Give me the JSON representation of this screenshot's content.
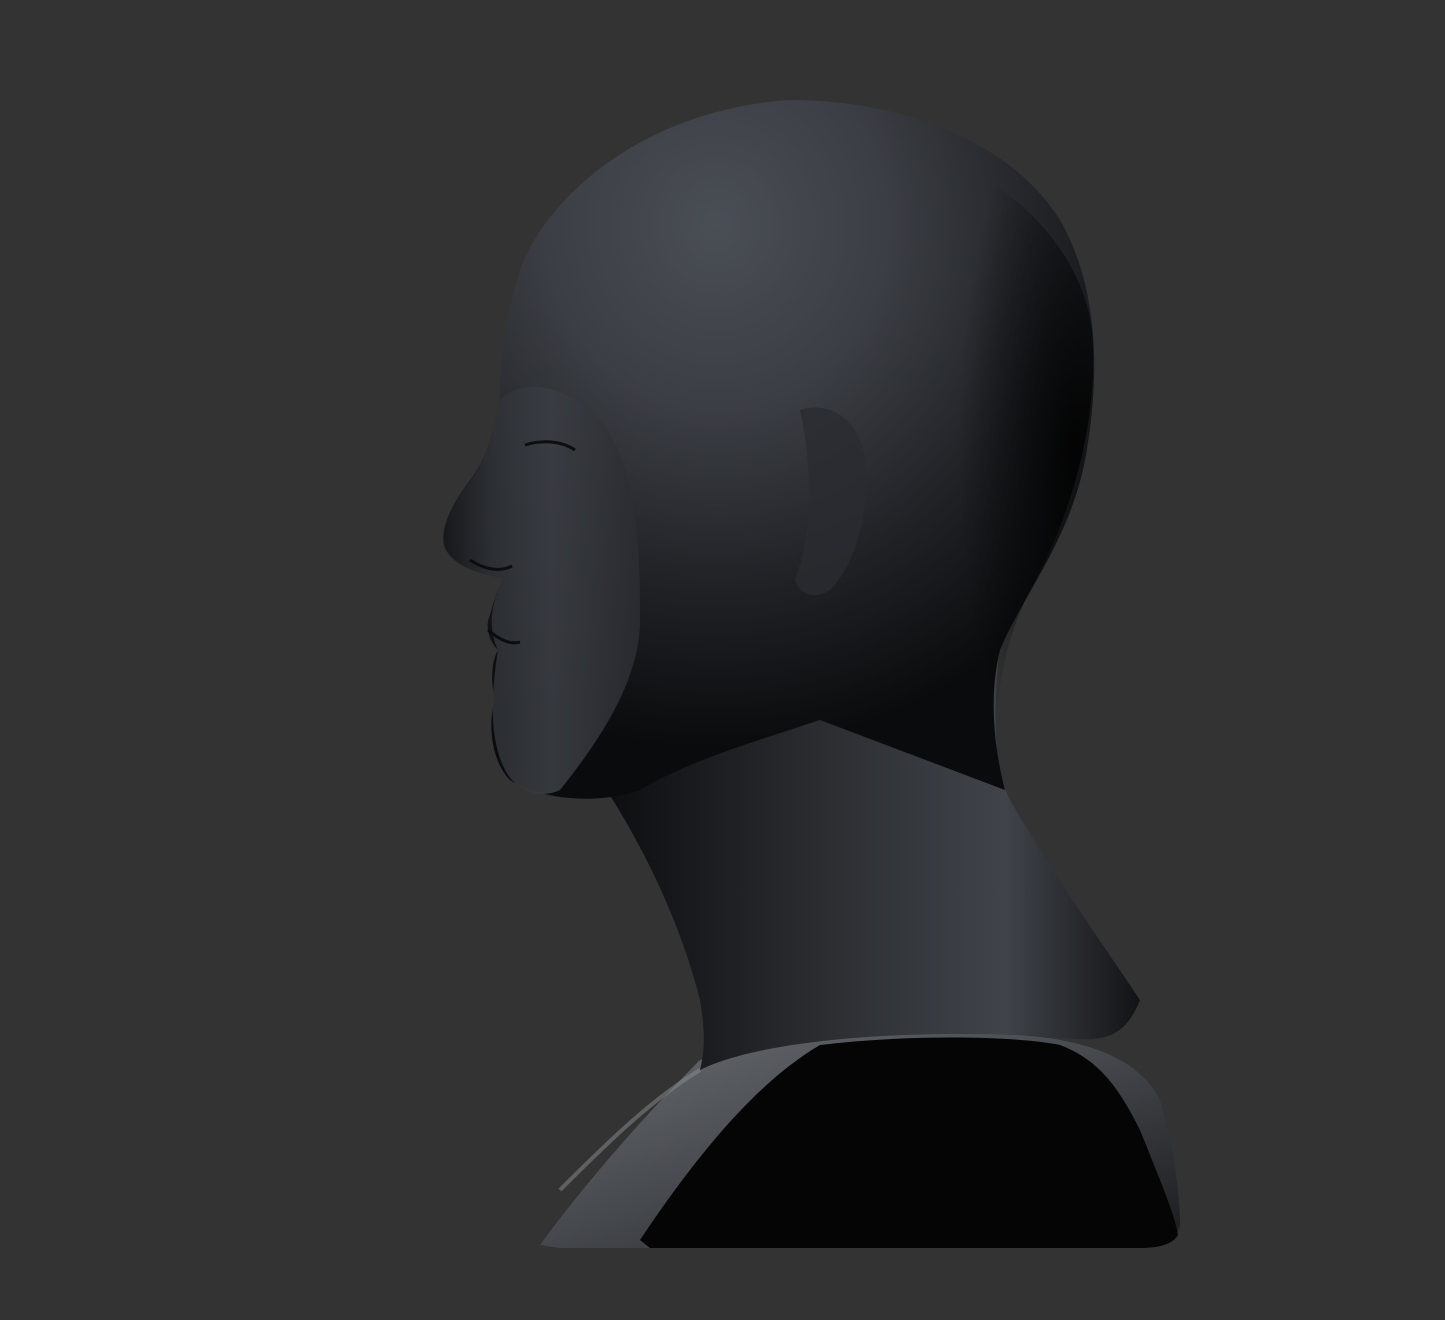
{
  "viewport": {
    "background": "#333333",
    "model": {
      "subject": "sculpted-head-bust",
      "view": "left-profile",
      "material_color": "#3a3d42"
    }
  }
}
